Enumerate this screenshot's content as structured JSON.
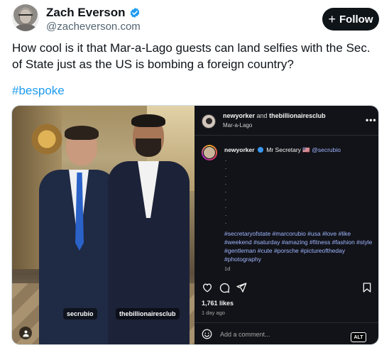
{
  "author": {
    "display_name": "Zach Everson",
    "handle": "@zacheverson.com",
    "verified": true
  },
  "follow_button": {
    "icon": "+",
    "label": "Follow"
  },
  "post": {
    "text": "How cool is it that Mar-a-Lago guests can land selfies with the Sec. of State just as the US is bombing a foreign country?",
    "hashtag": "#bespoke"
  },
  "media": {
    "photo_tags": [
      "secrubio",
      "thebillionairesclub"
    ],
    "alt_badge": "ALT",
    "instagram": {
      "header_user1": "newyorker",
      "header_and": "and",
      "header_user2": "thebillionairesclub",
      "location": "Mar-a-Lago",
      "more": "•••",
      "caption_author": "newyorker",
      "caption_text": "Mr Secretary 🇺🇸",
      "caption_mention": "@secrubio",
      "caption_dots": ".\n.\n.\n.\n.\n.\n.\n.\n.",
      "hashtags": "#secretaryofstate #marcorubio #usa #love #like #weekend #saturday #amazing #fitness #fashion #style #gentleman #cute #porsche #pictureoftheday #photography",
      "age": "1d",
      "likes": "1,761 likes",
      "date": "1 day ago",
      "comment_placeholder": "Add a comment..."
    }
  },
  "colors": {
    "link_blue": "#1d9bf0",
    "follow_bg": "#0f1419",
    "ig_bg": "#121318",
    "ig_hashtag": "#9fb5ff"
  },
  "icons": [
    "verified-badge-icon",
    "plus-icon",
    "more-icon",
    "heart-icon",
    "comment-icon",
    "share-icon",
    "bookmark-icon",
    "emoji-icon",
    "user-tag-icon"
  ]
}
